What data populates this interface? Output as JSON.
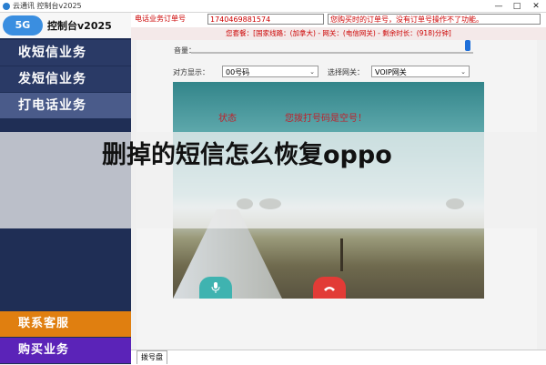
{
  "window": {
    "title": "云通讯 控制台v2025",
    "minimize": "—",
    "maximize": "□",
    "close": "✕"
  },
  "sidebar": {
    "logo_badge": "5G",
    "logo_text": "控制台v2025",
    "items": [
      {
        "label": "收短信业务"
      },
      {
        "label": "发短信业务"
      },
      {
        "label": "打电话业务"
      }
    ],
    "contact_label": "联系客服",
    "buy_label": "购买业务"
  },
  "order": {
    "label": "电话业务订单号",
    "value": "1740469881574",
    "note": "您购买时的订单号，没有订单号操作不了功能。"
  },
  "package": {
    "text": "您套餐：[国家线路：(加拿大) - 网关：(电信网关) - 剩余时长：(918)分钟]"
  },
  "controls": {
    "volume_label": "音量：",
    "volume_level": 0.98,
    "display_label": "对方显示：",
    "display_value": "00号码",
    "gateway_label": "选择网关：",
    "gateway_value": "VOIP网关"
  },
  "call": {
    "status_label": "状态",
    "status_message": "您拨打号码是空号！",
    "mic_icon": "microphone-icon",
    "hangup_icon": "hangup-icon"
  },
  "tabs": {
    "dial_label": "拨号盘"
  },
  "overlay": {
    "text": "删掉的短信怎么恢复oppo"
  },
  "colors": {
    "sidebar_bg": "#1f2e55",
    "contact_bg": "#e07f10",
    "buy_bg": "#5b23b8",
    "alert_red": "#c0202a",
    "mic_teal": "#3fb3b0",
    "hangup_red": "#e23b36"
  }
}
